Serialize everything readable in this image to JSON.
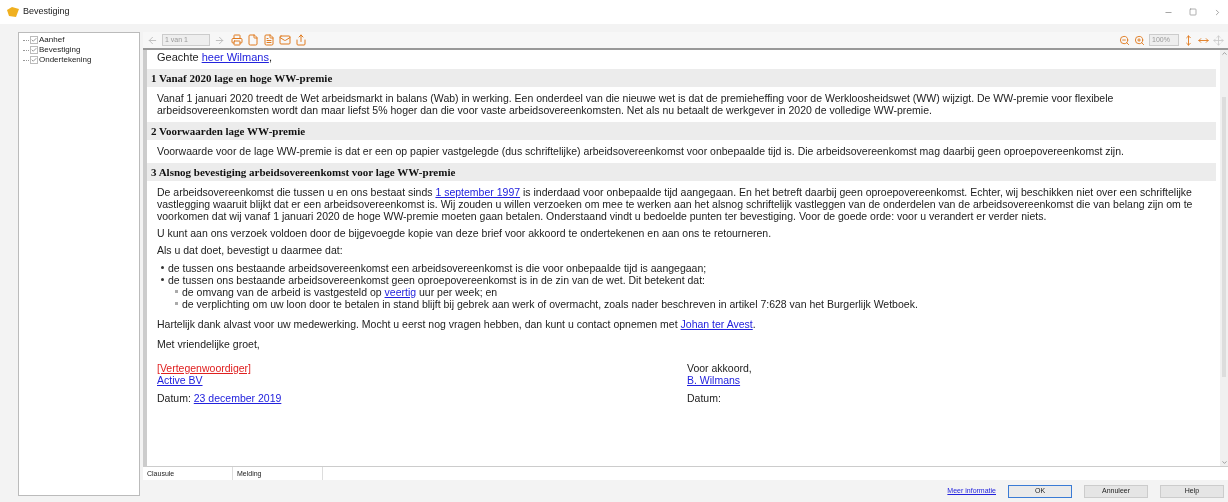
{
  "window": {
    "title": "Bevestiging"
  },
  "tree": [
    {
      "label": "Aanhef",
      "checked": true
    },
    {
      "label": "Bevestiging",
      "checked": true
    },
    {
      "label": "Ondertekening",
      "checked": true
    }
  ],
  "toolbar": {
    "page": "1 van 1",
    "zoom": "100%"
  },
  "document": {
    "greeting": [
      {
        "kind": "text",
        "text": "Geachte "
      },
      {
        "kind": "link",
        "text": "heer Wilmans"
      },
      {
        "kind": "text",
        "text": ","
      }
    ],
    "sections": [
      {
        "heading": "1 Vanaf 2020 lage en hoge WW-premie",
        "paragraphs": [
          [
            {
              "kind": "text",
              "text": "Vanaf 1 januari 2020 treedt de Wet arbeidsmarkt in balans (Wab) in werking. Een onderdeel van die nieuwe wet is dat de premieheffing voor de Werkloosheidswet (WW) wijzigt. De WW-premie voor flexibele arbeidsovereenkomsten wordt dan maar liefst 5% hoger dan die voor vaste arbeidsovereenkomsten. Net als nu betaalt de werkgever in 2020 de volledige WW-premie."
            }
          ]
        ]
      },
      {
        "heading": "2 Voorwaarden lage WW-premie",
        "paragraphs": [
          [
            {
              "kind": "text",
              "text": "Voorwaarde voor de lage WW-premie is dat er een op papier vastgelegde (dus schriftelijke) arbeidsovereenkomst voor onbepaalde tijd is. Die arbeidsovereenkomst mag daarbij geen oproepovereenkomst zijn."
            }
          ]
        ]
      },
      {
        "heading": "3 Alsnog bevestiging arbeidsovereenkomst voor lage WW-premie",
        "paragraphs": [
          [
            {
              "kind": "text",
              "text": "De arbeidsovereenkomst die tussen u en ons bestaat sinds "
            },
            {
              "kind": "link",
              "text": "1 september 1997"
            },
            {
              "kind": "text",
              "text": " is inderdaad voor onbepaalde tijd aangegaan. En het betreft daarbij geen oproepovereenkomst. Echter, wij beschikken niet over een schriftelijke vastlegging waaruit blijkt dat er een arbeidsovereenkomst is. Wij zouden u willen verzoeken om mee te werken aan het alsnog schriftelijk vastleggen van de onderdelen van de arbeidsovereenkomst die van belang zijn om te voorkomen dat wij vanaf 1 januari 2020 de hoge WW-premie moeten gaan betalen. Onderstaand vindt u bedoelde punten ter bevestiging. Voor de goede orde: voor u verandert er verder niets."
            }
          ],
          [
            {
              "kind": "text",
              "text": "U kunt aan ons verzoek voldoen door de bijgevoegde kopie van deze brief voor akkoord te ondertekenen en aan ons te retourneren."
            }
          ],
          [
            {
              "kind": "text",
              "text": "Als u dat doet, bevestigt u daarmee dat:"
            }
          ]
        ]
      }
    ],
    "bullets": [
      {
        "parts": [
          {
            "kind": "text",
            "text": "de tussen ons bestaande arbeidsovereenkomst een arbeidsovereenkomst is die voor onbepaalde tijd is aangegaan;"
          }
        ]
      },
      {
        "parts": [
          {
            "kind": "text",
            "text": "de tussen ons bestaande arbeidsovereenkomst geen oproepovereenkomst is in de zin van de wet. Dit betekent dat:"
          }
        ],
        "children": [
          {
            "parts": [
              {
                "kind": "text",
                "text": "de omvang van de arbeid is vastgesteld op "
              },
              {
                "kind": "link",
                "text": "veertig"
              },
              {
                "kind": "text",
                "text": " uur per week; en"
              }
            ]
          },
          {
            "parts": [
              {
                "kind": "text",
                "text": "de verplichting om uw loon door te betalen in stand blijft bij gebrek aan werk of overmacht, zoals nader beschreven in artikel 7:628 van het Burgerlijk Wetboek."
              }
            ]
          }
        ]
      }
    ],
    "closing": [
      [
        {
          "kind": "text",
          "text": "Hartelijk dank alvast voor uw medewerking. Mocht u eerst nog vragen hebben, dan kunt u contact opnemen met "
        },
        {
          "kind": "link",
          "text": "Johan ter Avest"
        },
        {
          "kind": "text",
          "text": "."
        }
      ],
      [
        {
          "kind": "text",
          "text": "Met vriendelijke groet,"
        }
      ]
    ],
    "signatures": [
      [
        [
          {
            "kind": "missing",
            "text": "[Vertegenwoordiger]"
          }
        ],
        [
          {
            "kind": "link",
            "text": "Active BV"
          }
        ],
        [
          {
            "kind": "text",
            "text": "Datum: "
          },
          {
            "kind": "link",
            "text": "23 december 2019"
          }
        ]
      ],
      [
        [
          {
            "kind": "text",
            "text": "Voor akkoord,"
          }
        ],
        [
          {
            "kind": "link",
            "text": "B. Wilmans"
          }
        ],
        [
          {
            "kind": "text",
            "text": "Datum:"
          }
        ]
      ]
    ]
  },
  "bottom_tabs": [
    "Clausule",
    "Melding"
  ],
  "footer": {
    "link": "Meer informatie",
    "buttons": [
      "OK",
      "Annuleer",
      "Help"
    ]
  }
}
